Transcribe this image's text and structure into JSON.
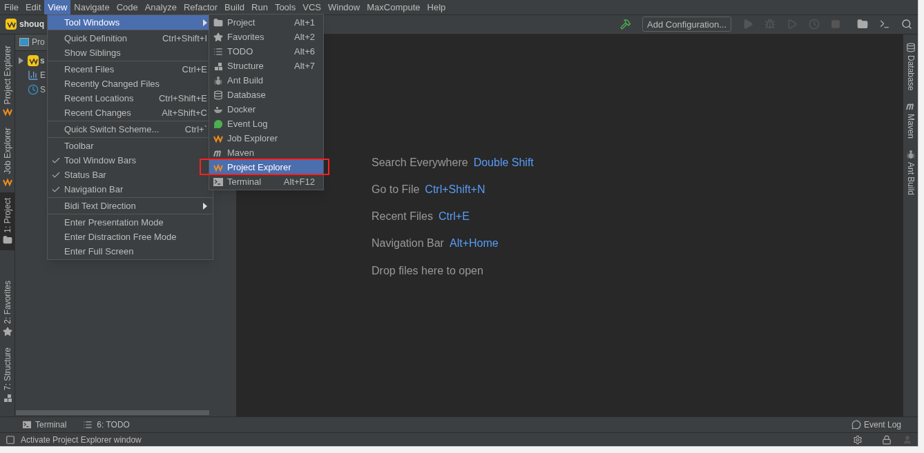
{
  "menu_bar": [
    {
      "label": "File",
      "selected": false
    },
    {
      "label": "Edit",
      "selected": false
    },
    {
      "label": "View",
      "selected": true
    },
    {
      "label": "Navigate",
      "selected": false
    },
    {
      "label": "Code",
      "selected": false
    },
    {
      "label": "Analyze",
      "selected": false
    },
    {
      "label": "Refactor",
      "selected": false
    },
    {
      "label": "Build",
      "selected": false
    },
    {
      "label": "Run",
      "selected": false
    },
    {
      "label": "Tools",
      "selected": false
    },
    {
      "label": "VCS",
      "selected": false
    },
    {
      "label": "Window",
      "selected": false
    },
    {
      "label": "MaxCompute",
      "selected": false
    },
    {
      "label": "Help",
      "selected": false
    }
  ],
  "navigation_bar": {
    "breadcrumb": "shouq",
    "run_configuration": "Add Configuration..."
  },
  "left_stripe": [
    {
      "label": "Project Explorer",
      "selected": false
    },
    {
      "label": "Job Explorer",
      "selected": false
    },
    {
      "label": "1: Project",
      "selected": true
    },
    {
      "label": "2: Favorites",
      "selected": false
    },
    {
      "label": "7: Structure",
      "selected": false
    }
  ],
  "project_panel": {
    "title": "Pro",
    "tree": [
      {
        "label": "s",
        "expanded": false
      },
      {
        "label": "E"
      },
      {
        "label": "S"
      }
    ]
  },
  "view_menu": [
    [
      {
        "label": "Tool Windows",
        "submenu": true,
        "checked": false,
        "selected": true
      }
    ],
    [
      {
        "label": "Quick Definition",
        "shortcut": "Ctrl+Shift+I",
        "submenu": false,
        "checked": false,
        "selected": false
      },
      {
        "label": "Show Siblings",
        "submenu": false,
        "checked": false,
        "selected": false
      }
    ],
    [
      {
        "label": "Recent Files",
        "shortcut": "Ctrl+E",
        "submenu": false,
        "checked": false,
        "selected": false
      },
      {
        "label": "Recently Changed Files",
        "submenu": false,
        "checked": false,
        "selected": false
      },
      {
        "label": "Recent Locations",
        "shortcut": "Ctrl+Shift+E",
        "submenu": false,
        "checked": false,
        "selected": false
      },
      {
        "label": "Recent Changes",
        "shortcut": "Alt+Shift+C",
        "submenu": false,
        "checked": false,
        "selected": false
      }
    ],
    [
      {
        "label": "Quick Switch Scheme...",
        "shortcut": "Ctrl+`",
        "submenu": false,
        "checked": false,
        "selected": false
      }
    ],
    [
      {
        "label": "Toolbar",
        "submenu": false,
        "checked": false,
        "selected": false
      },
      {
        "label": "Tool Window Bars",
        "submenu": false,
        "checked": true,
        "selected": false
      },
      {
        "label": "Status Bar",
        "submenu": false,
        "checked": true,
        "selected": false
      },
      {
        "label": "Navigation Bar",
        "submenu": false,
        "checked": true,
        "selected": false
      }
    ],
    [
      {
        "label": "Bidi Text Direction",
        "submenu": true,
        "checked": false,
        "selected": false
      }
    ],
    [
      {
        "label": "Enter Presentation Mode",
        "submenu": false,
        "checked": false,
        "selected": false
      },
      {
        "label": "Enter Distraction Free Mode",
        "submenu": false,
        "checked": false,
        "selected": false
      },
      {
        "label": "Enter Full Screen",
        "submenu": false,
        "checked": false,
        "selected": false
      }
    ]
  ],
  "tool_windows_menu": [
    {
      "label": "Project",
      "shortcut": "Alt+1",
      "selected": false,
      "highlighted": false
    },
    {
      "label": "Favorites",
      "shortcut": "Alt+2",
      "selected": false,
      "highlighted": false
    },
    {
      "label": "TODO",
      "shortcut": "Alt+6",
      "selected": false,
      "highlighted": false
    },
    {
      "label": "Structure",
      "shortcut": "Alt+7",
      "selected": false,
      "highlighted": false
    },
    {
      "label": "Ant Build",
      "selected": false,
      "highlighted": false
    },
    {
      "label": "Database",
      "selected": false,
      "highlighted": false
    },
    {
      "label": "Docker",
      "selected": false,
      "highlighted": false
    },
    {
      "label": "Event Log",
      "selected": false,
      "highlighted": false
    },
    {
      "label": "Job Explorer",
      "selected": false,
      "highlighted": false
    },
    {
      "label": "Maven",
      "selected": false,
      "highlighted": false
    },
    {
      "label": "Project Explorer",
      "selected": true,
      "highlighted": true
    },
    {
      "label": "Terminal",
      "shortcut": "Alt+F12",
      "selected": false,
      "highlighted": false
    }
  ],
  "welcome": {
    "hints": [
      {
        "label": "Search Everywhere",
        "shortcut": "Double Shift"
      },
      {
        "label": "Go to File",
        "shortcut": "Ctrl+Shift+N"
      },
      {
        "label": "Recent Files",
        "shortcut": "Ctrl+E"
      },
      {
        "label": "Navigation Bar",
        "shortcut": "Alt+Home"
      }
    ],
    "drop_text": "Drop files here to open"
  },
  "right_stripe": [
    {
      "label": "Database"
    },
    {
      "label": "Maven"
    },
    {
      "label": "Ant Build"
    }
  ],
  "bottom_tabs": [
    {
      "label": "Terminal"
    },
    {
      "label": "6: TODO"
    }
  ],
  "event_log": "Event Log",
  "status_bar": {
    "message": "Activate Project Explorer window"
  }
}
